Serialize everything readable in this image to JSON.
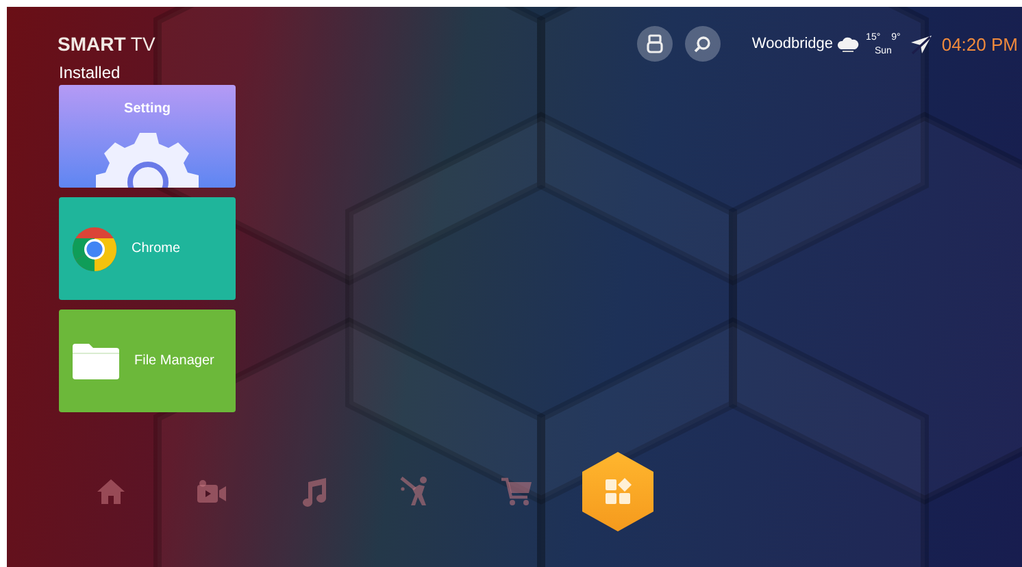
{
  "header": {
    "logo": "**SMART** TV",
    "buttons": [
      {
        "kind": "usb"
      },
      {
        "kind": "search"
      }
    ],
    "weather": {
      "city": "Woodbridge",
      "high": "15°",
      "low": "9°",
      "day": "Sun"
    },
    "time": "04:20 PM"
  },
  "installed": {
    "title": "Installed",
    "apps": [
      {
        "name": "Setting",
        "kind": "settings",
        "color": "#8f8cf0"
      },
      {
        "name": "Chrome",
        "kind": "chrome",
        "color": "#1fb59b"
      },
      {
        "name": "File Manager",
        "kind": "files",
        "color": "#6cb83a"
      }
    ]
  },
  "nav": [
    {
      "kind": "home",
      "selected": false
    },
    {
      "kind": "video",
      "selected": false
    },
    {
      "kind": "music",
      "selected": false
    },
    {
      "kind": "sports",
      "selected": false
    },
    {
      "kind": "cart",
      "selected": false
    },
    {
      "kind": "apps",
      "selected": true
    }
  ]
}
